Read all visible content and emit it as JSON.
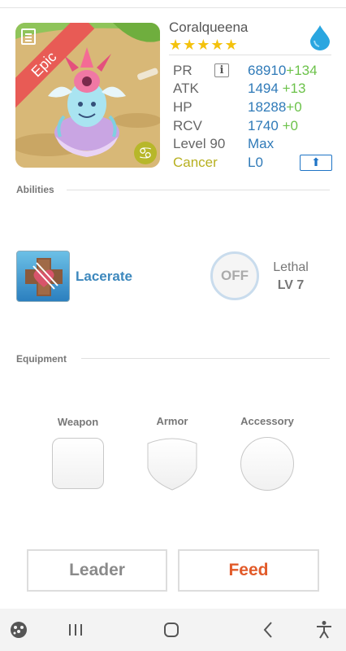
{
  "monster": {
    "name": "Coralqueena",
    "rarity": "Epic",
    "stars": "★★★★★",
    "zodiac_glyph": "♋",
    "element_icon": "water-drop-icon"
  },
  "stats": {
    "pr": {
      "label": "PR",
      "value": "68910",
      "bonus": "+134"
    },
    "atk": {
      "label": "ATK",
      "value": "1494",
      "bonus": "+13"
    },
    "hp": {
      "label": "HP",
      "value": "18288",
      "bonus": "+0"
    },
    "rcv": {
      "label": "RCV",
      "value": "1740",
      "bonus": "+0"
    },
    "level": {
      "label": "Level 90",
      "value": "Max"
    },
    "sign": {
      "label": "Cancer",
      "value": "L0"
    },
    "info_label": "i",
    "upgrade_icon": "⬆"
  },
  "abilities": {
    "title": "Abilities",
    "active": {
      "name": "Lacerate",
      "icon": "lacerate-icon"
    },
    "passive": {
      "toggle": "OFF",
      "name": "Lethal",
      "level": "LV 7"
    }
  },
  "equipment": {
    "title": "Equipment",
    "slots": [
      {
        "label": "Weapon"
      },
      {
        "label": "Armor"
      },
      {
        "label": "Accessory"
      }
    ]
  },
  "actions": {
    "leader": "Leader",
    "feed": "Feed"
  },
  "colors": {
    "stat_value": "#2f7ab8",
    "stat_bonus": "#6cc24a",
    "feed": "#e25b2a",
    "epic_ribbon": "#e85b55",
    "cancer": "#b7b020"
  }
}
